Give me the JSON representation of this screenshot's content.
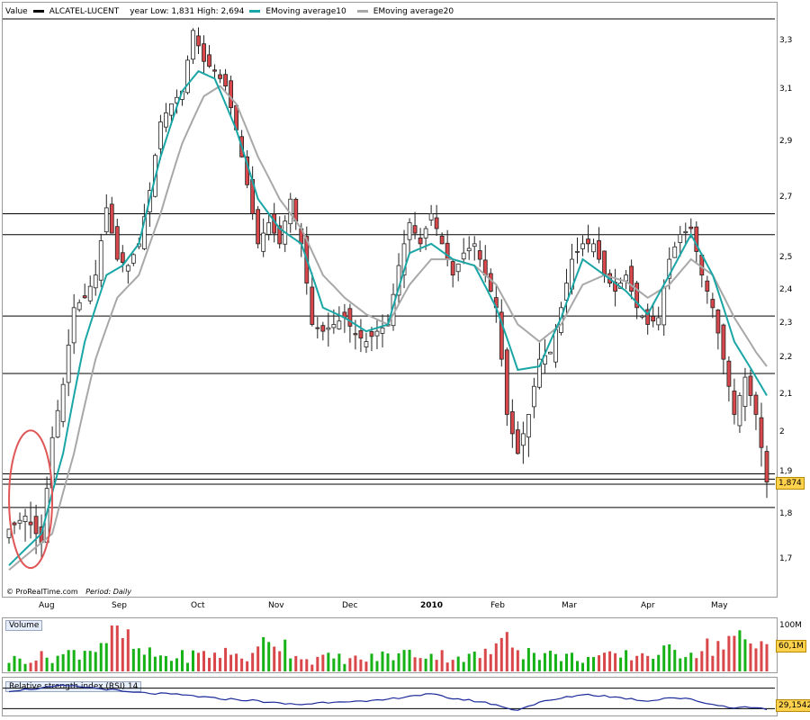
{
  "main_panel": {
    "header": {
      "value_label": "Value",
      "instrument": "ALCATEL-LUCENT",
      "range_text": "year Low: 1,831 High: 2,694",
      "ema10_label": "EMoving average10",
      "ema20_label": "EMoving average20"
    },
    "credit": "© ProRealTime.com",
    "period_label": "Period:",
    "period_value": "Daily",
    "last_price_tag": "1,874"
  },
  "volume_panel": {
    "label": "Volume",
    "axis_label": "100M",
    "last_value_tag": "60,1M"
  },
  "rsi_panel": {
    "label": "Relative strength index (RSI) 14",
    "last_value_tag": "29,1542"
  },
  "chart_data": {
    "type": "candlestick",
    "instrument": "ALCATEL-LUCENT",
    "period": "Daily",
    "x_tick_labels": [
      "Aug",
      "Sep",
      "Oct",
      "Nov",
      "Dec",
      "2010",
      "Feb",
      "Mar",
      "Apr",
      "May"
    ],
    "y_tick_labels": [
      "3,3",
      "3,1",
      "2,9",
      "2,7",
      "2,5",
      "2,4",
      "2,3",
      "2,2",
      "2,1",
      "2",
      "1,9",
      "1,8",
      "1,7"
    ],
    "y_ticks": [
      3.3,
      3.1,
      2.9,
      2.7,
      2.5,
      2.4,
      2.3,
      2.2,
      2.1,
      2.0,
      1.9,
      1.8,
      1.7
    ],
    "ylim": [
      1.65,
      3.4
    ],
    "y_scale": "log",
    "horizontal_lines": [
      2.65,
      2.58,
      2.325,
      2.16,
      1.9,
      1.887,
      1.875,
      1.82
    ],
    "close_path": [
      [
        0,
        1.77
      ],
      [
        3,
        1.8
      ],
      [
        6,
        1.74
      ],
      [
        8,
        1.99
      ],
      [
        10,
        2.13
      ],
      [
        12,
        2.35
      ],
      [
        14,
        2.38
      ],
      [
        16,
        2.45
      ],
      [
        18,
        2.67
      ],
      [
        20,
        2.5
      ],
      [
        22,
        2.48
      ],
      [
        24,
        2.55
      ],
      [
        26,
        2.73
      ],
      [
        28,
        2.98
      ],
      [
        30,
        3.05
      ],
      [
        32,
        3.1
      ],
      [
        34,
        3.35
      ],
      [
        36,
        3.22
      ],
      [
        38,
        3.18
      ],
      [
        40,
        3.12
      ],
      [
        42,
        2.95
      ],
      [
        44,
        2.75
      ],
      [
        46,
        2.55
      ],
      [
        48,
        2.62
      ],
      [
        50,
        2.55
      ],
      [
        52,
        2.7
      ],
      [
        54,
        2.55
      ],
      [
        56,
        2.3
      ],
      [
        58,
        2.28
      ],
      [
        60,
        2.3
      ],
      [
        62,
        2.32
      ],
      [
        64,
        2.27
      ],
      [
        66,
        2.25
      ],
      [
        68,
        2.28
      ],
      [
        70,
        2.3
      ],
      [
        72,
        2.48
      ],
      [
        74,
        2.62
      ],
      [
        76,
        2.55
      ],
      [
        78,
        2.65
      ],
      [
        80,
        2.55
      ],
      [
        82,
        2.45
      ],
      [
        84,
        2.52
      ],
      [
        86,
        2.55
      ],
      [
        88,
        2.45
      ],
      [
        90,
        2.35
      ],
      [
        92,
        2.05
      ],
      [
        94,
        1.95
      ],
      [
        96,
        2.05
      ],
      [
        98,
        2.2
      ],
      [
        100,
        2.22
      ],
      [
        102,
        2.35
      ],
      [
        104,
        2.5
      ],
      [
        106,
        2.55
      ],
      [
        108,
        2.55
      ],
      [
        110,
        2.45
      ],
      [
        112,
        2.4
      ],
      [
        114,
        2.45
      ],
      [
        116,
        2.35
      ],
      [
        118,
        2.3
      ],
      [
        120,
        2.32
      ],
      [
        122,
        2.5
      ],
      [
        124,
        2.58
      ],
      [
        126,
        2.6
      ],
      [
        128,
        2.45
      ],
      [
        130,
        2.35
      ],
      [
        132,
        2.2
      ],
      [
        134,
        2.05
      ],
      [
        136,
        2.15
      ],
      [
        138,
        2.05
      ],
      [
        140,
        1.88
      ]
    ],
    "ema10_path": [
      [
        0,
        1.69
      ],
      [
        6,
        1.76
      ],
      [
        10,
        1.95
      ],
      [
        14,
        2.25
      ],
      [
        18,
        2.45
      ],
      [
        21,
        2.48
      ],
      [
        24,
        2.55
      ],
      [
        28,
        2.85
      ],
      [
        32,
        3.1
      ],
      [
        35,
        3.18
      ],
      [
        38,
        3.15
      ],
      [
        42,
        2.95
      ],
      [
        46,
        2.7
      ],
      [
        50,
        2.6
      ],
      [
        54,
        2.55
      ],
      [
        58,
        2.35
      ],
      [
        62,
        2.32
      ],
      [
        66,
        2.28
      ],
      [
        70,
        2.3
      ],
      [
        74,
        2.52
      ],
      [
        78,
        2.55
      ],
      [
        82,
        2.5
      ],
      [
        86,
        2.48
      ],
      [
        90,
        2.35
      ],
      [
        94,
        2.17
      ],
      [
        98,
        2.18
      ],
      [
        102,
        2.32
      ],
      [
        106,
        2.5
      ],
      [
        110,
        2.45
      ],
      [
        114,
        2.4
      ],
      [
        118,
        2.33
      ],
      [
        122,
        2.45
      ],
      [
        126,
        2.58
      ],
      [
        130,
        2.45
      ],
      [
        134,
        2.25
      ],
      [
        138,
        2.15
      ],
      [
        140,
        2.1
      ]
    ],
    "ema20_path": [
      [
        0,
        1.68
      ],
      [
        8,
        1.76
      ],
      [
        12,
        1.95
      ],
      [
        16,
        2.2
      ],
      [
        20,
        2.38
      ],
      [
        24,
        2.45
      ],
      [
        28,
        2.65
      ],
      [
        32,
        2.9
      ],
      [
        36,
        3.08
      ],
      [
        39,
        3.12
      ],
      [
        42,
        3.05
      ],
      [
        46,
        2.85
      ],
      [
        50,
        2.7
      ],
      [
        54,
        2.6
      ],
      [
        58,
        2.45
      ],
      [
        62,
        2.38
      ],
      [
        66,
        2.33
      ],
      [
        70,
        2.3
      ],
      [
        74,
        2.42
      ],
      [
        78,
        2.5
      ],
      [
        82,
        2.5
      ],
      [
        86,
        2.48
      ],
      [
        90,
        2.42
      ],
      [
        94,
        2.3
      ],
      [
        98,
        2.25
      ],
      [
        102,
        2.3
      ],
      [
        106,
        2.42
      ],
      [
        110,
        2.45
      ],
      [
        114,
        2.43
      ],
      [
        118,
        2.38
      ],
      [
        122,
        2.42
      ],
      [
        126,
        2.5
      ],
      [
        130,
        2.45
      ],
      [
        134,
        2.32
      ],
      [
        138,
        2.22
      ],
      [
        140,
        2.18
      ]
    ],
    "volume_path": [
      [
        0,
        25
      ],
      [
        10,
        35
      ],
      [
        16,
        55
      ],
      [
        20,
        90
      ],
      [
        24,
        40
      ],
      [
        30,
        30
      ],
      [
        34,
        35
      ],
      [
        40,
        40
      ],
      [
        45,
        30
      ],
      [
        48,
        80
      ],
      [
        55,
        25
      ],
      [
        60,
        30
      ],
      [
        65,
        25
      ],
      [
        70,
        35
      ],
      [
        75,
        40
      ],
      [
        80,
        35
      ],
      [
        85,
        30
      ],
      [
        90,
        45
      ],
      [
        92,
        100
      ],
      [
        95,
        45
      ],
      [
        100,
        35
      ],
      [
        105,
        30
      ],
      [
        110,
        30
      ],
      [
        115,
        35
      ],
      [
        120,
        40
      ],
      [
        125,
        45
      ],
      [
        130,
        55
      ],
      [
        134,
        75
      ],
      [
        137,
        50
      ],
      [
        140,
        60
      ]
    ],
    "rsi_path": [
      [
        0,
        65
      ],
      [
        6,
        70
      ],
      [
        10,
        75
      ],
      [
        14,
        72
      ],
      [
        18,
        68
      ],
      [
        22,
        62
      ],
      [
        26,
        60
      ],
      [
        30,
        58
      ],
      [
        34,
        55
      ],
      [
        38,
        50
      ],
      [
        42,
        48
      ],
      [
        46,
        45
      ],
      [
        50,
        40
      ],
      [
        54,
        38
      ],
      [
        58,
        42
      ],
      [
        62,
        45
      ],
      [
        66,
        43
      ],
      [
        70,
        48
      ],
      [
        74,
        55
      ],
      [
        78,
        58
      ],
      [
        82,
        50
      ],
      [
        86,
        45
      ],
      [
        90,
        38
      ],
      [
        92,
        30
      ],
      [
        94,
        28
      ],
      [
        98,
        42
      ],
      [
        102,
        50
      ],
      [
        106,
        58
      ],
      [
        110,
        55
      ],
      [
        114,
        50
      ],
      [
        118,
        45
      ],
      [
        122,
        52
      ],
      [
        126,
        48
      ],
      [
        130,
        38
      ],
      [
        134,
        32
      ],
      [
        137,
        33
      ],
      [
        140,
        29
      ]
    ],
    "annotation": "red ellipse around early-August breakout candles",
    "colors": {
      "bull": "#16b216",
      "bear": "#d9474b",
      "ema10": "#1aa6a6",
      "ema20": "#a8a8a8",
      "rsi": "#1c2b99",
      "grid_line": "#000000",
      "annotation": "#e05555",
      "tag": "#ffd24d"
    }
  }
}
